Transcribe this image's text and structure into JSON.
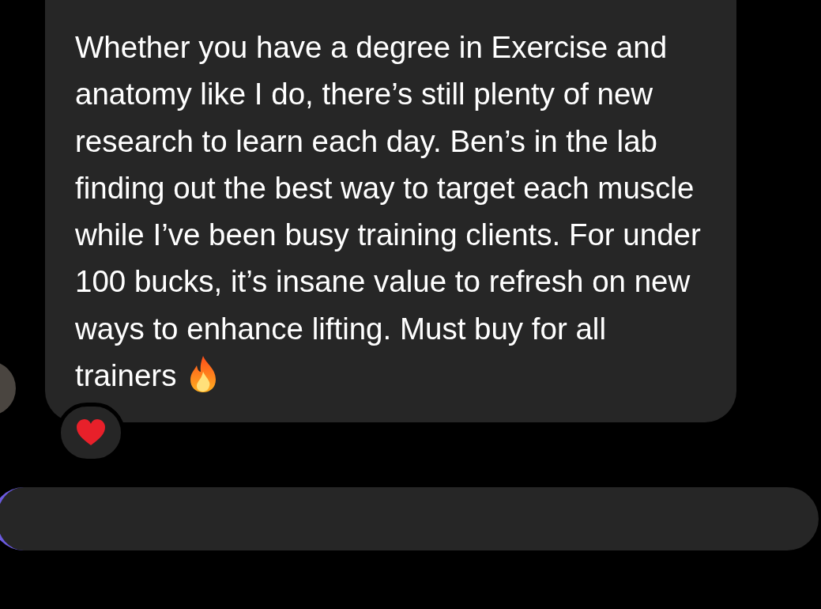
{
  "message": {
    "text": "Whether you have a degree in Exercise and anatomy like I do, there’s still plenty of new research to learn each day. Ben’s in the lab finding out the best way to target each muscle while I’ve been busy training clients. For under 100 bucks, it’s insane value to refresh on new ways to enhance lifting. Must buy for all trainers",
    "reacted": true
  }
}
